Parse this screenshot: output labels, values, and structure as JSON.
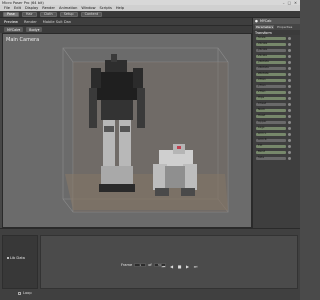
{
  "window": {
    "title": "Micro Poser Pro (64 bit)"
  },
  "menus": [
    "File",
    "Edit",
    "Display",
    "Render",
    "Animation",
    "Window",
    "Scripts",
    "Help"
  ],
  "modes": [
    {
      "label": "Pose",
      "active": true
    },
    {
      "label": "Hair",
      "active": false
    },
    {
      "label": "Cloth",
      "active": false
    },
    {
      "label": "Setup",
      "active": false
    },
    {
      "label": "Content",
      "active": false
    }
  ],
  "subtabs": [
    {
      "label": "Preview",
      "selected": true
    },
    {
      "label": "Render",
      "selected": false
    },
    {
      "label": "Mobile Suit Dan",
      "selected": false
    }
  ],
  "viewport": {
    "figure_select": "MYCab",
    "actor_select": "Body",
    "camera_label": "Main Camera"
  },
  "right_panel": {
    "figure": "MYCab",
    "tabs": [
      "Parameters",
      "Properties"
    ],
    "section": "Transform",
    "params": [
      "Scale",
      "xScale",
      "yScale",
      "zScale",
      "yRotate",
      "xRotate",
      "zRotate",
      "xTran",
      "yTran",
      "zTran",
      "Hips",
      "Chest",
      "Neck",
      "Head",
      "Upper",
      "Legs",
      "Arm L",
      "Arm R",
      "Tilt",
      "Bend",
      "Side"
    ]
  },
  "bottom": {
    "library_label": "Lib Data",
    "frame_label": "Frame",
    "frame_value": "1",
    "of_label": "of",
    "frame_total": "30",
    "loop_label": "Loop"
  },
  "colors": {
    "viewport_bg": "#6b6b6b",
    "grid_box": "#8a8a8a",
    "slider_green": "#77886b"
  },
  "icons": {
    "minimize": "minimize-icon",
    "maximize": "maximize-icon",
    "close": "close-icon"
  }
}
